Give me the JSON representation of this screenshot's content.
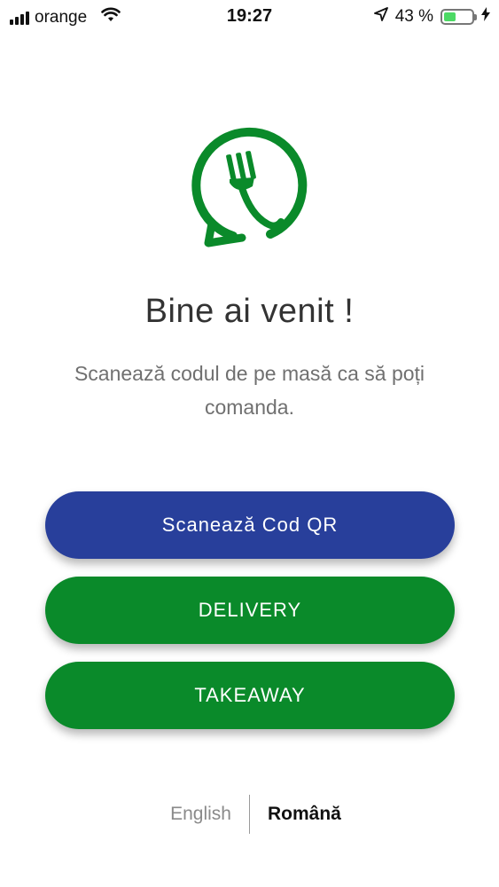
{
  "status_bar": {
    "carrier": "orange",
    "time": "19:27",
    "battery_percent": "43 %",
    "battery_level": 0.43,
    "signal_icon": "cellular-signal-icon",
    "wifi_icon": "wifi-icon",
    "location_icon": "location-arrow-icon",
    "charging_icon": "charging-bolt-icon"
  },
  "logo": {
    "icon": "fork-speech-bubble-logo",
    "color": "#0a8a2a"
  },
  "welcome": {
    "title": "Bine ai venit !",
    "subtitle": "Scanează codul de pe masă ca să poți comanda."
  },
  "buttons": {
    "scan_qr": "Scanează Cod QR",
    "delivery": "DELIVERY",
    "takeaway": "TAKEAWAY"
  },
  "language": {
    "english": "English",
    "romanian": "Română",
    "selected": "Română"
  },
  "colors": {
    "primary_blue": "#283f9b",
    "primary_green": "#0a8a2a"
  }
}
